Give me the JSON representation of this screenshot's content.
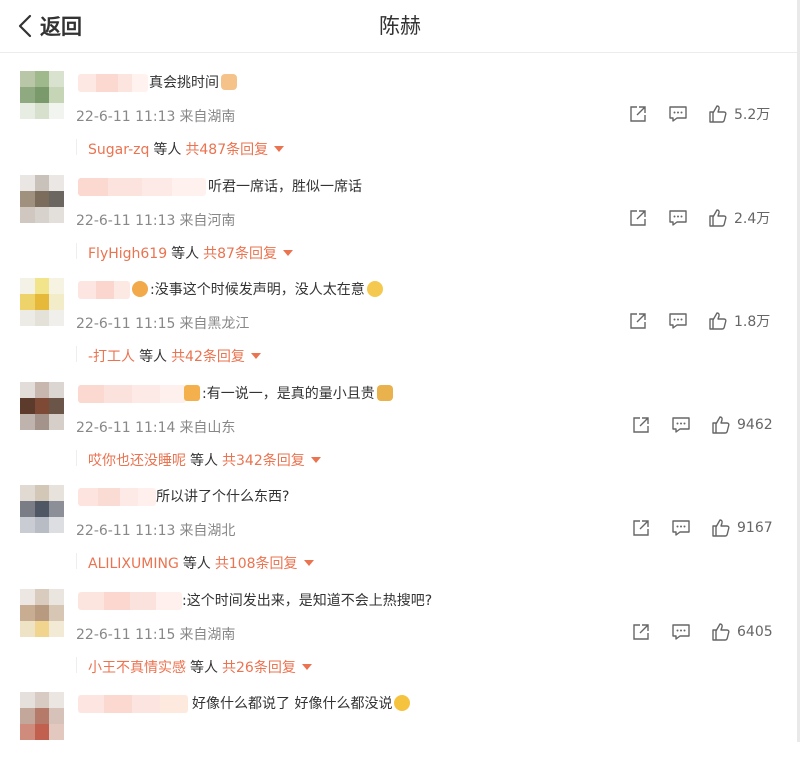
{
  "header": {
    "back_label": "返回",
    "title": "陈赫"
  },
  "comments": [
    {
      "text": "真会挑时间",
      "emoji": "thumbs-up-emoji",
      "time": "22-6-11 11:13",
      "location": "来自湖南",
      "likes": "5.2万",
      "reply_user": "Sugar-zq",
      "reply_mid": "等人",
      "reply_count": "共487条回复"
    },
    {
      "text": "听君一席话，胜似一席话",
      "emoji": "",
      "time": "22-6-11 11:13",
      "location": "来自河南",
      "likes": "2.4万",
      "reply_user": "FlyHigh619",
      "reply_mid": "等人",
      "reply_count": "共87条回复"
    },
    {
      "text": ":没事这个时候发声明，没人太在意",
      "emoji": "shrug-emoji",
      "time": "22-6-11 11:15",
      "location": "来自黑龙江",
      "likes": "1.8万",
      "reply_user": "-打工人",
      "reply_mid": "等人",
      "reply_count": "共42条回复"
    },
    {
      "text": ":有一说一，是真的量小且贵",
      "emoji": "person-emoji",
      "time": "22-6-11 11:14",
      "location": "来自山东",
      "likes": "9462",
      "reply_user": "哎你也还没睡呢",
      "reply_mid": "等人",
      "reply_count": "共342条回复"
    },
    {
      "text": "所以讲了个什么东西?",
      "emoji": "",
      "time": "22-6-11 11:13",
      "location": "来自湖北",
      "likes": "9167",
      "reply_user": "ALILIXUMING",
      "reply_mid": "等人",
      "reply_count": "共108条回复"
    },
    {
      "text": ":这个时间发出来，是知道不会上热搜吧?",
      "emoji": "",
      "time": "22-6-11 11:15",
      "location": "来自湖南",
      "likes": "6405",
      "reply_user": "小王不真情实感",
      "reply_mid": "等人",
      "reply_count": "共26条回复"
    },
    {
      "text": "好像什么都说了 好像什么都没说",
      "emoji": "upside-down-face-emoji",
      "time": "",
      "location": "",
      "likes": "",
      "reply_user": "",
      "reply_mid": "",
      "reply_count": ""
    }
  ],
  "colors": {
    "accent": "#eb7350",
    "meta": "#888888",
    "text": "#333333"
  }
}
